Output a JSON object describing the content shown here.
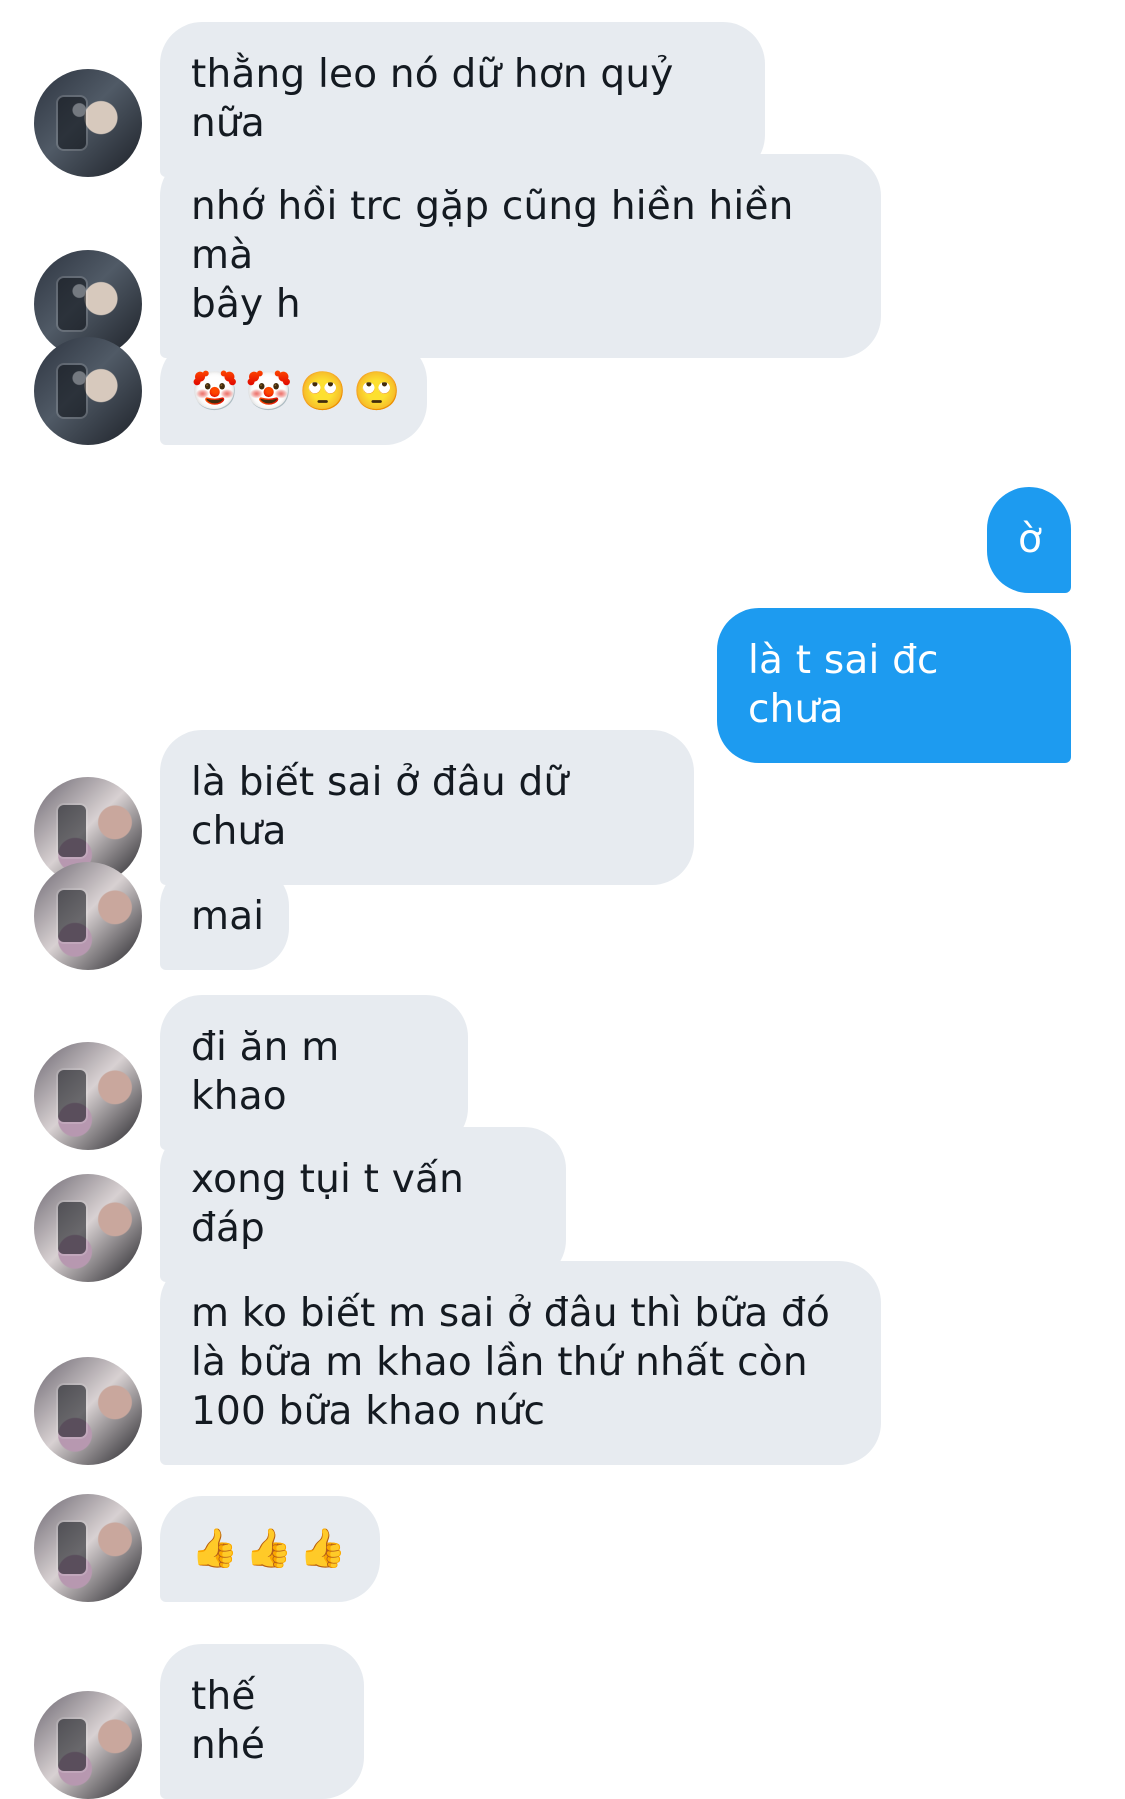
{
  "messages": [
    {
      "direction": "incoming",
      "avatar": "a1",
      "text": "thằng leo nó dữ hơn quỷ nữa"
    },
    {
      "direction": "incoming",
      "avatar": "a1",
      "text": "nhớ hồi trc gặp cũng hiền hiền mà\nbây h"
    },
    {
      "direction": "incoming",
      "avatar": "a1",
      "emojis": [
        "🤡",
        "🤡",
        "🙄",
        "🙄"
      ]
    },
    {
      "direction": "outgoing",
      "text": "ờ"
    },
    {
      "direction": "outgoing",
      "text": "là t sai đc chưa"
    },
    {
      "direction": "incoming",
      "avatar": "a2",
      "text": "là biết sai ở đâu dữ chưa"
    },
    {
      "direction": "incoming",
      "avatar": "a2",
      "text": "mai"
    },
    {
      "direction": "incoming",
      "avatar": "a2",
      "text": "đi ăn m khao"
    },
    {
      "direction": "incoming",
      "avatar": "a2",
      "text": "xong tụi t vấn đáp"
    },
    {
      "direction": "incoming",
      "avatar": "a2",
      "text": "m ko biết m sai ở đâu thì bữa đó\nlà bữa m khao lần thứ nhất còn\n100 bữa khao nức"
    },
    {
      "direction": "incoming",
      "avatar": "a2",
      "emojis": [
        "👍",
        "👍",
        "👍"
      ]
    },
    {
      "direction": "incoming",
      "avatar": "a2",
      "text": "thế nhé"
    }
  ],
  "colors": {
    "incoming_bubble": "#e7ebf0",
    "outgoing_bubble": "#1d9bf0",
    "incoming_text": "#141a21",
    "outgoing_text": "#ffffff"
  }
}
